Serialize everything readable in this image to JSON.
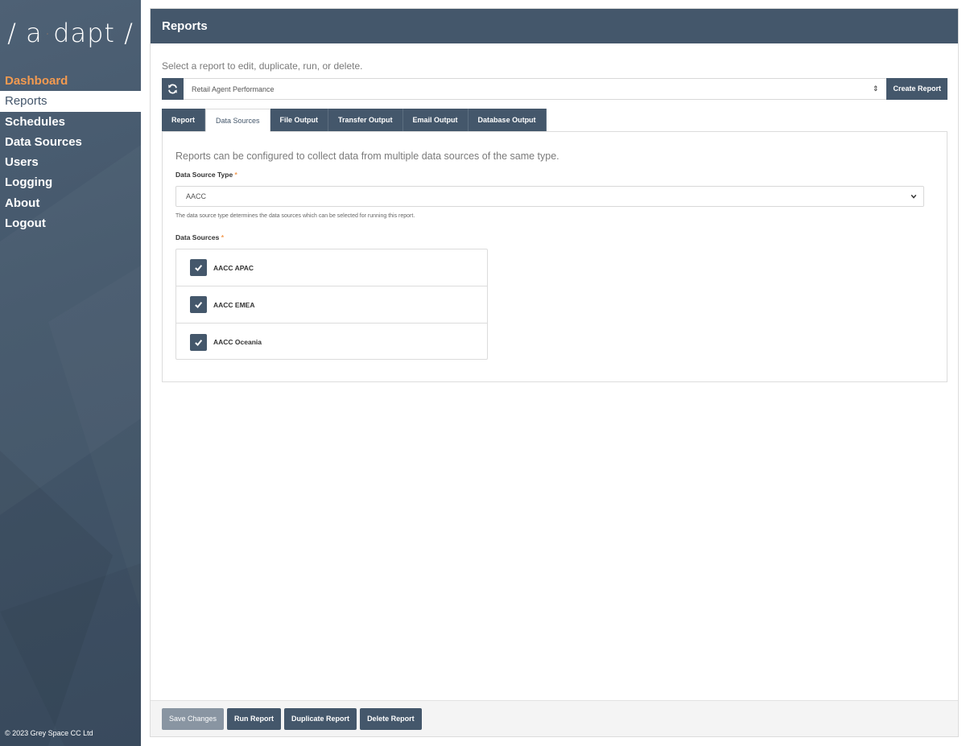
{
  "sidebar": {
    "logo": {
      "left": "/ a",
      "dot": "·",
      "right": "dapt /"
    },
    "items": [
      {
        "label": "Dashboard"
      },
      {
        "label": "Reports"
      },
      {
        "label": "Schedules"
      },
      {
        "label": "Data Sources"
      },
      {
        "label": "Users"
      },
      {
        "label": "Logging"
      },
      {
        "label": "About"
      },
      {
        "label": "Logout"
      }
    ],
    "copyright": "© 2023 Grey Space CC Ltd"
  },
  "header": {
    "title": "Reports"
  },
  "main": {
    "intro": "Select a report to edit, duplicate, run, or delete.",
    "report_selector": {
      "value": "Retail Agent Performance",
      "arrows": "⇕"
    },
    "create_button": "Create Report",
    "tabs": [
      {
        "label": "Report"
      },
      {
        "label": "Data Sources"
      },
      {
        "label": "File Output"
      },
      {
        "label": "Transfer Output"
      },
      {
        "label": "Email Output"
      },
      {
        "label": "Database Output"
      }
    ],
    "data_sources_tab": {
      "intro": "Reports can be configured to collect data from multiple data sources of the same type.",
      "type_label": "Data Source Type",
      "required_mark": "*",
      "type_value": "AACC",
      "type_help": "The data source type determines the data sources which can be selected for running this report.",
      "sources_label": "Data Sources",
      "sources": [
        {
          "label": "AACC APAC",
          "checked": true
        },
        {
          "label": "AACC EMEA",
          "checked": true
        },
        {
          "label": "AACC Oceania",
          "checked": true
        }
      ]
    }
  },
  "footer": {
    "save": "Save Changes",
    "run": "Run Report",
    "duplicate": "Duplicate Report",
    "delete": "Delete Report"
  },
  "colors": {
    "primary": "#44576b",
    "accent": "#f39a50",
    "disabled": "#8995a2"
  },
  "icons": {
    "refresh": "refresh-icon",
    "check": "check-icon",
    "chevron": "chevron-down-icon"
  }
}
